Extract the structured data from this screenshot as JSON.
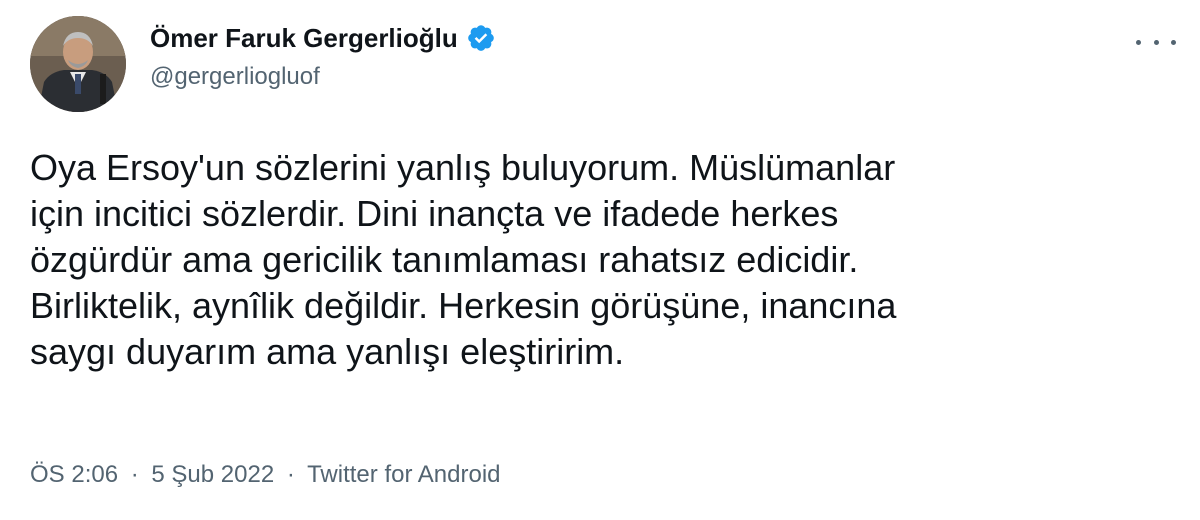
{
  "author": {
    "display_name": "Ömer Faruk Gergerlioğlu",
    "handle": "@gergerliogluof",
    "verified_icon": "verified-badge-icon",
    "avatar_icon": "profile-photo"
  },
  "tweet": {
    "lines": [
      "Oya Ersoy'un sözlerini yanlış buluyorum. Müslümanlar",
      "için incitici sözlerdir. Dini inançta ve ifadede herkes",
      "özgürdür ama gericilik tanımlaması rahatsız edicidir.",
      "Birliktelik, aynîlik değildir. Herkesin görüşüne, inancına",
      "saygı duyarım ama yanlışı eleştiririm."
    ]
  },
  "meta": {
    "time": "ÖS 2:06",
    "date": "5 Şub 2022",
    "source": "Twitter for Android",
    "separator": "·"
  },
  "colors": {
    "text": "#0f1419",
    "secondary": "#536471",
    "verified": "#1d9bf0"
  }
}
